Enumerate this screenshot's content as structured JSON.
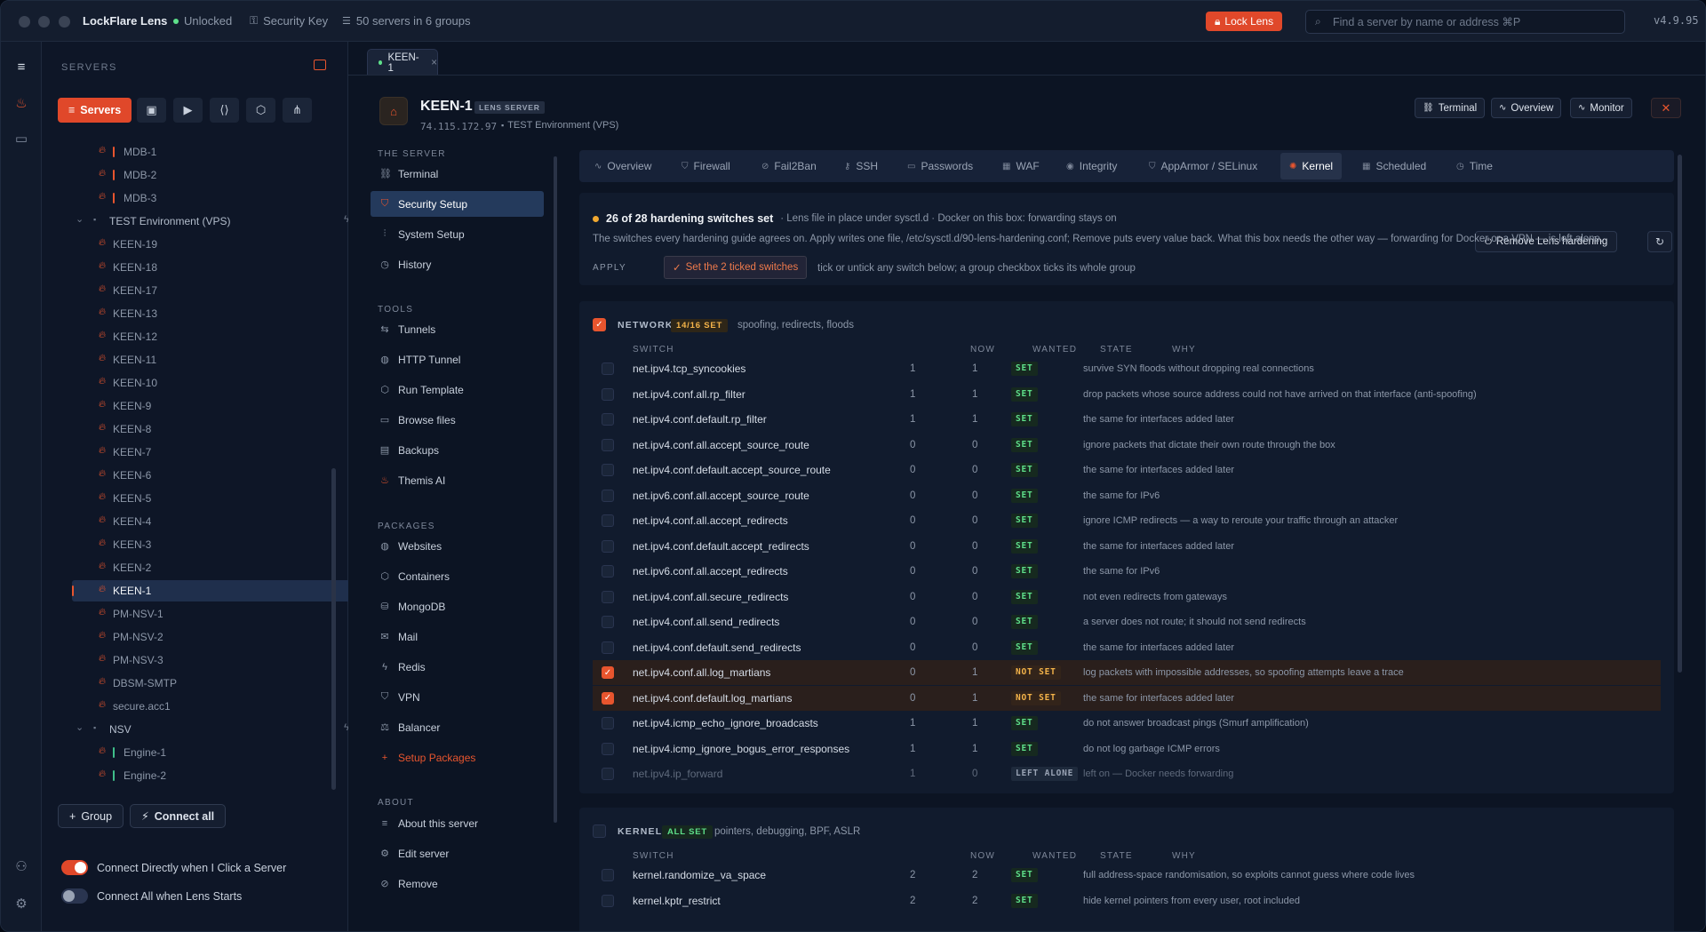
{
  "app": {
    "title": "LockFlare Lens",
    "lock_state": "Unlocked",
    "key_label": "Security Key",
    "server_count": "50 servers in 6 groups",
    "lock_button": "Lock Lens",
    "search_placeholder": "Find a server by name or address ⌘P",
    "version": "v4.9.95",
    "colors": {
      "accent": "#e8552e",
      "unlocked": "#5ee08a",
      "bg": "#0c1423"
    }
  },
  "sidebar": {
    "heading": "SERVERS",
    "servers_tab": "Servers",
    "tree": [
      {
        "label": "MDB-1",
        "type": "server",
        "bar": "#e8552e"
      },
      {
        "label": "MDB-2",
        "type": "server",
        "bar": "#e8552e"
      },
      {
        "label": "MDB-3",
        "type": "server",
        "bar": "#e8552e"
      },
      {
        "label": "TEST Environment (VPS)",
        "type": "group"
      },
      {
        "label": "KEEN-19",
        "type": "server"
      },
      {
        "label": "KEEN-18",
        "type": "server"
      },
      {
        "label": "KEEN-17",
        "type": "server"
      },
      {
        "label": "KEEN-13",
        "type": "server"
      },
      {
        "label": "KEEN-12",
        "type": "server"
      },
      {
        "label": "KEEN-11",
        "type": "server"
      },
      {
        "label": "KEEN-10",
        "type": "server"
      },
      {
        "label": "KEEN-9",
        "type": "server"
      },
      {
        "label": "KEEN-8",
        "type": "server"
      },
      {
        "label": "KEEN-7",
        "type": "server"
      },
      {
        "label": "KEEN-6",
        "type": "server"
      },
      {
        "label": "KEEN-5",
        "type": "server"
      },
      {
        "label": "KEEN-4",
        "type": "server"
      },
      {
        "label": "KEEN-3",
        "type": "server"
      },
      {
        "label": "KEEN-2",
        "type": "server"
      },
      {
        "label": "KEEN-1",
        "type": "server",
        "selected": true
      },
      {
        "label": "PM-NSV-1",
        "type": "server"
      },
      {
        "label": "PM-NSV-2",
        "type": "server"
      },
      {
        "label": "PM-NSV-3",
        "type": "server"
      },
      {
        "label": "DBSM-SMTP",
        "type": "server"
      },
      {
        "label": "secure.acc1",
        "type": "server"
      },
      {
        "label": "NSV",
        "type": "group"
      },
      {
        "label": "Engine-1",
        "type": "server",
        "bar": "#3fbf8a"
      },
      {
        "label": "Engine-2",
        "type": "server",
        "bar": "#3fbf8a"
      }
    ],
    "group_button": "Group",
    "connect_all_button": "Connect all",
    "toggle_direct": "Connect Directly when I Click a Server",
    "toggle_start": "Connect All when Lens Starts"
  },
  "main": {
    "doc_tab": "KEEN-1",
    "server": {
      "name": "KEEN-1",
      "badge": "LENS SERVER",
      "ip": "74.115.172.97",
      "env": "TEST Environment (VPS)"
    },
    "header_buttons": {
      "terminal": "Terminal",
      "overview": "Overview",
      "monitor": "Monitor"
    },
    "nav": {
      "the_server": "THE SERVER",
      "server_items": [
        "Terminal",
        "Security Setup",
        "System Setup",
        "History"
      ],
      "tools": "TOOLS",
      "tool_items": [
        "Tunnels",
        "HTTP Tunnel",
        "Run Template",
        "Browse files",
        "Backups",
        "Themis AI"
      ],
      "packages": "PACKAGES",
      "package_items": [
        "Websites",
        "Containers",
        "MongoDB",
        "Mail",
        "Redis",
        "VPN",
        "Balancer",
        "Setup Packages"
      ],
      "about": "ABOUT",
      "about_items": [
        "About this server",
        "Edit server",
        "Remove"
      ]
    },
    "tabs": [
      "Overview",
      "Firewall",
      "Fail2Ban",
      "SSH",
      "Passwords",
      "WAF",
      "Integrity",
      "AppArmor / SELinux",
      "Kernel",
      "Scheduled",
      "Time"
    ],
    "status": {
      "headline": "26 of 28 hardening switches set",
      "sub": "· Lens file in place under sysctl.d · Docker on this box: forwarding stays on",
      "desc": "The switches every hardening guide agrees on. Apply writes one file, /etc/sysctl.d/90-lens-hardening.conf; Remove puts every value back. What this box needs the other way — forwarding for Docker or a VPN — is left alone.",
      "apply_label": "APPLY",
      "apply_button": "Set the 2 ticked switches",
      "apply_hint": "tick or untick any switch below; a group checkbox ticks its whole group",
      "remove_button": "Remove Lens hardening"
    },
    "columns": {
      "switch": "SWITCH",
      "now": "NOW",
      "wanted": "WANTED",
      "state": "STATE",
      "why": "WHY"
    },
    "network": {
      "title": "NETWORK",
      "badge": "14/16 SET",
      "desc": "spoofing, redirects, floods",
      "rows": [
        {
          "switch": "net.ipv4.tcp_syncookies",
          "now": "1",
          "wanted": "1",
          "state": "SET",
          "why": "survive SYN floods without dropping real connections"
        },
        {
          "switch": "net.ipv4.conf.all.rp_filter",
          "now": "1",
          "wanted": "1",
          "state": "SET",
          "why": "drop packets whose source address could not have arrived on that interface (anti-spoofing)"
        },
        {
          "switch": "net.ipv4.conf.default.rp_filter",
          "now": "1",
          "wanted": "1",
          "state": "SET",
          "why": "the same for interfaces added later"
        },
        {
          "switch": "net.ipv4.conf.all.accept_source_route",
          "now": "0",
          "wanted": "0",
          "state": "SET",
          "why": "ignore packets that dictate their own route through the box"
        },
        {
          "switch": "net.ipv4.conf.default.accept_source_route",
          "now": "0",
          "wanted": "0",
          "state": "SET",
          "why": "the same for interfaces added later"
        },
        {
          "switch": "net.ipv6.conf.all.accept_source_route",
          "now": "0",
          "wanted": "0",
          "state": "SET",
          "why": "the same for IPv6"
        },
        {
          "switch": "net.ipv4.conf.all.accept_redirects",
          "now": "0",
          "wanted": "0",
          "state": "SET",
          "why": "ignore ICMP redirects — a way to reroute your traffic through an attacker"
        },
        {
          "switch": "net.ipv4.conf.default.accept_redirects",
          "now": "0",
          "wanted": "0",
          "state": "SET",
          "why": "the same for interfaces added later"
        },
        {
          "switch": "net.ipv6.conf.all.accept_redirects",
          "now": "0",
          "wanted": "0",
          "state": "SET",
          "why": "the same for IPv6"
        },
        {
          "switch": "net.ipv4.conf.all.secure_redirects",
          "now": "0",
          "wanted": "0",
          "state": "SET",
          "why": "not even redirects from gateways"
        },
        {
          "switch": "net.ipv4.conf.all.send_redirects",
          "now": "0",
          "wanted": "0",
          "state": "SET",
          "why": "a server does not route; it should not send redirects"
        },
        {
          "switch": "net.ipv4.conf.default.send_redirects",
          "now": "0",
          "wanted": "0",
          "state": "SET",
          "why": "the same for interfaces added later"
        },
        {
          "switch": "net.ipv4.conf.all.log_martians",
          "now": "0",
          "wanted": "1",
          "state": "NOT SET",
          "why": "log packets with impossible addresses, so spoofing attempts leave a trace",
          "checked": true
        },
        {
          "switch": "net.ipv4.conf.default.log_martians",
          "now": "0",
          "wanted": "1",
          "state": "NOT SET",
          "why": "the same for interfaces added later",
          "checked": true
        },
        {
          "switch": "net.ipv4.icmp_echo_ignore_broadcasts",
          "now": "1",
          "wanted": "1",
          "state": "SET",
          "why": "do not answer broadcast pings (Smurf amplification)"
        },
        {
          "switch": "net.ipv4.icmp_ignore_bogus_error_responses",
          "now": "1",
          "wanted": "1",
          "state": "SET",
          "why": "do not log garbage ICMP errors"
        },
        {
          "switch": "net.ipv4.ip_forward",
          "now": "1",
          "wanted": "0",
          "state": "LEFT ALONE",
          "why": "left on — Docker needs forwarding",
          "dim": true
        }
      ]
    },
    "kernel": {
      "title": "KERNEL",
      "badge": "ALL SET",
      "desc": "pointers, debugging, BPF, ASLR",
      "rows": [
        {
          "switch": "kernel.randomize_va_space",
          "now": "2",
          "wanted": "2",
          "state": "SET",
          "why": "full address-space randomisation, so exploits cannot guess where code lives"
        },
        {
          "switch": "kernel.kptr_restrict",
          "now": "2",
          "wanted": "2",
          "state": "SET",
          "why": "hide kernel pointers from every user, root included"
        }
      ]
    }
  }
}
